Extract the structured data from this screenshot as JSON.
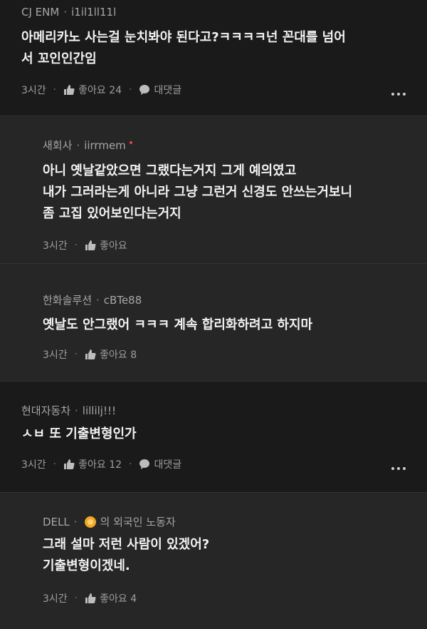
{
  "comments": [
    {
      "author": "CJ ENM",
      "user": "i1il1ll11l",
      "body": [
        "아메리카노 사는걸 눈치봐야 된다고?ㅋㅋㅋㅋ넌 꼰대를 넘어",
        "서 꼬인인간임"
      ],
      "time": "3시간",
      "like_label": "좋아요 24",
      "reply_label": "대댓글"
    },
    {
      "author": "새회사",
      "user": "iirrmem",
      "body": [
        "아니 옛날같았으면 그랬다는거지 그게 예의였고",
        "내가 그러라는게 아니라 그냥 그런거 신경도 안쓰는거보니",
        "좀 고집 있어보인다는거지"
      ],
      "time": "3시간",
      "like_label": "좋아요"
    },
    {
      "author": "한화솔루션",
      "user": "cBTe88",
      "body": [
        "옛날도 안그랬어 ㅋㅋㅋ 계속 합리화하려고 하지마"
      ],
      "time": "3시간",
      "like_label": "좋아요 8"
    },
    {
      "author": "현대자동차",
      "user": "lillilj!!!",
      "body": [
        "ㅅㅂ 또 기출변형인가"
      ],
      "time": "3시간",
      "like_label": "좋아요 12",
      "reply_label": "대댓글"
    },
    {
      "author": "DELL",
      "user_suffix": "의 외국인 노동자",
      "body": [
        "그래 설마 저런 사람이 있겠어?",
        "기출변형이겠네."
      ],
      "time": "3시간",
      "like_label": "좋아요 4"
    }
  ],
  "colors": {
    "background": "#1e1e1e",
    "top_comment_bg": "#1a1a1a",
    "reply_bg": "#262626",
    "badge": "#f5a623",
    "new_dot": "#e0434f"
  }
}
